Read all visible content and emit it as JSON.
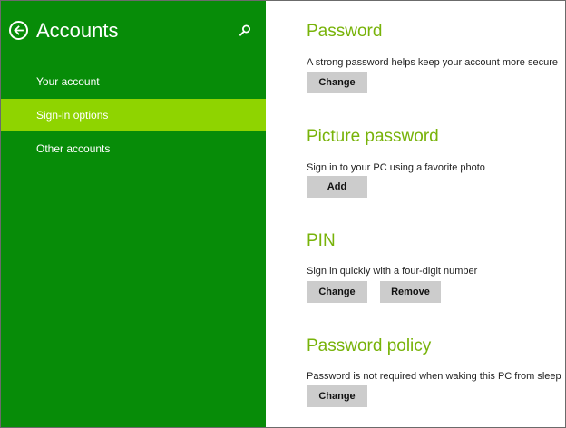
{
  "sidebar": {
    "title": "Accounts",
    "items": [
      {
        "label": "Your account"
      },
      {
        "label": "Sign-in options"
      },
      {
        "label": "Other accounts"
      }
    ]
  },
  "sections": {
    "password": {
      "title": "Password",
      "description": "A strong password helps keep your account more secure",
      "change_label": "Change"
    },
    "picture_password": {
      "title": "Picture password",
      "description": "Sign in to your PC using a favorite photo",
      "add_label": "Add"
    },
    "pin": {
      "title": "PIN",
      "description": "Sign in quickly with a four-digit number",
      "change_label": "Change",
      "remove_label": "Remove"
    },
    "password_policy": {
      "title": "Password policy",
      "description": "Password is not required when waking this PC from sleep",
      "change_label": "Change"
    }
  },
  "colors": {
    "sidebar_bg": "#078c08",
    "selected_item_bg": "#8fd400",
    "heading_green": "#78b30a",
    "button_bg": "#cccccc"
  },
  "icons": [
    "back-arrow-icon",
    "search-icon"
  ]
}
